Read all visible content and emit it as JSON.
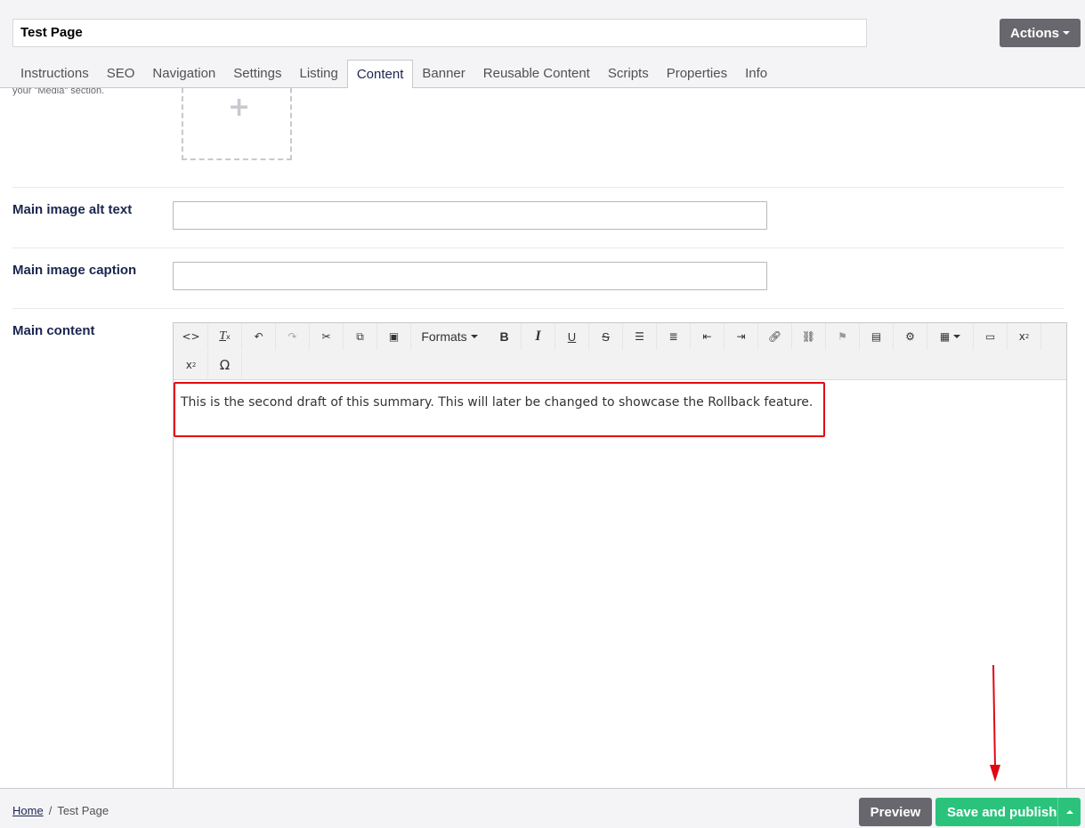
{
  "header": {
    "page_title_value": "Test Page",
    "actions_label": "Actions"
  },
  "tabs": [
    {
      "label": "Instructions"
    },
    {
      "label": "SEO"
    },
    {
      "label": "Navigation"
    },
    {
      "label": "Settings"
    },
    {
      "label": "Listing"
    },
    {
      "label": "Content",
      "active": true
    },
    {
      "label": "Banner"
    },
    {
      "label": "Reusable Content"
    },
    {
      "label": "Scripts"
    },
    {
      "label": "Properties"
    },
    {
      "label": "Info"
    }
  ],
  "content": {
    "media_help_text": "your \"Media\" section.",
    "alt_text_label": "Main image alt text",
    "alt_text_value": "",
    "caption_label": "Main image caption",
    "caption_value": "",
    "main_content_label": "Main content",
    "editor_text": "This is the second draft of this summary. This will later be changed to showcase the Rollback feature.",
    "formats_label": "Formats"
  },
  "toolbar_icons": [
    "source-code-icon",
    "clear-formatting-icon",
    "undo-icon",
    "redo-icon",
    "cut-icon",
    "copy-icon",
    "paste-icon",
    "formats-dropdown",
    "bold-icon",
    "italic-icon",
    "underline-icon",
    "strikethrough-icon",
    "bullet-list-icon",
    "numbered-list-icon",
    "outdent-icon",
    "indent-icon",
    "link-icon",
    "unlink-icon",
    "anchor-icon",
    "image-icon",
    "settings-icon",
    "table-icon",
    "fullscreen-icon",
    "subscript-icon",
    "superscript-icon",
    "special-character-icon"
  ],
  "footer": {
    "breadcrumb_home": "Home",
    "breadcrumb_separator": "/",
    "breadcrumb_current": "Test Page",
    "preview_label": "Preview",
    "save_publish_label": "Save and publish"
  },
  "colors": {
    "primary_dark": "#68676d",
    "save_green": "#2bc37c",
    "highlight_red": "#e30613",
    "text_navy": "#1b264f"
  }
}
